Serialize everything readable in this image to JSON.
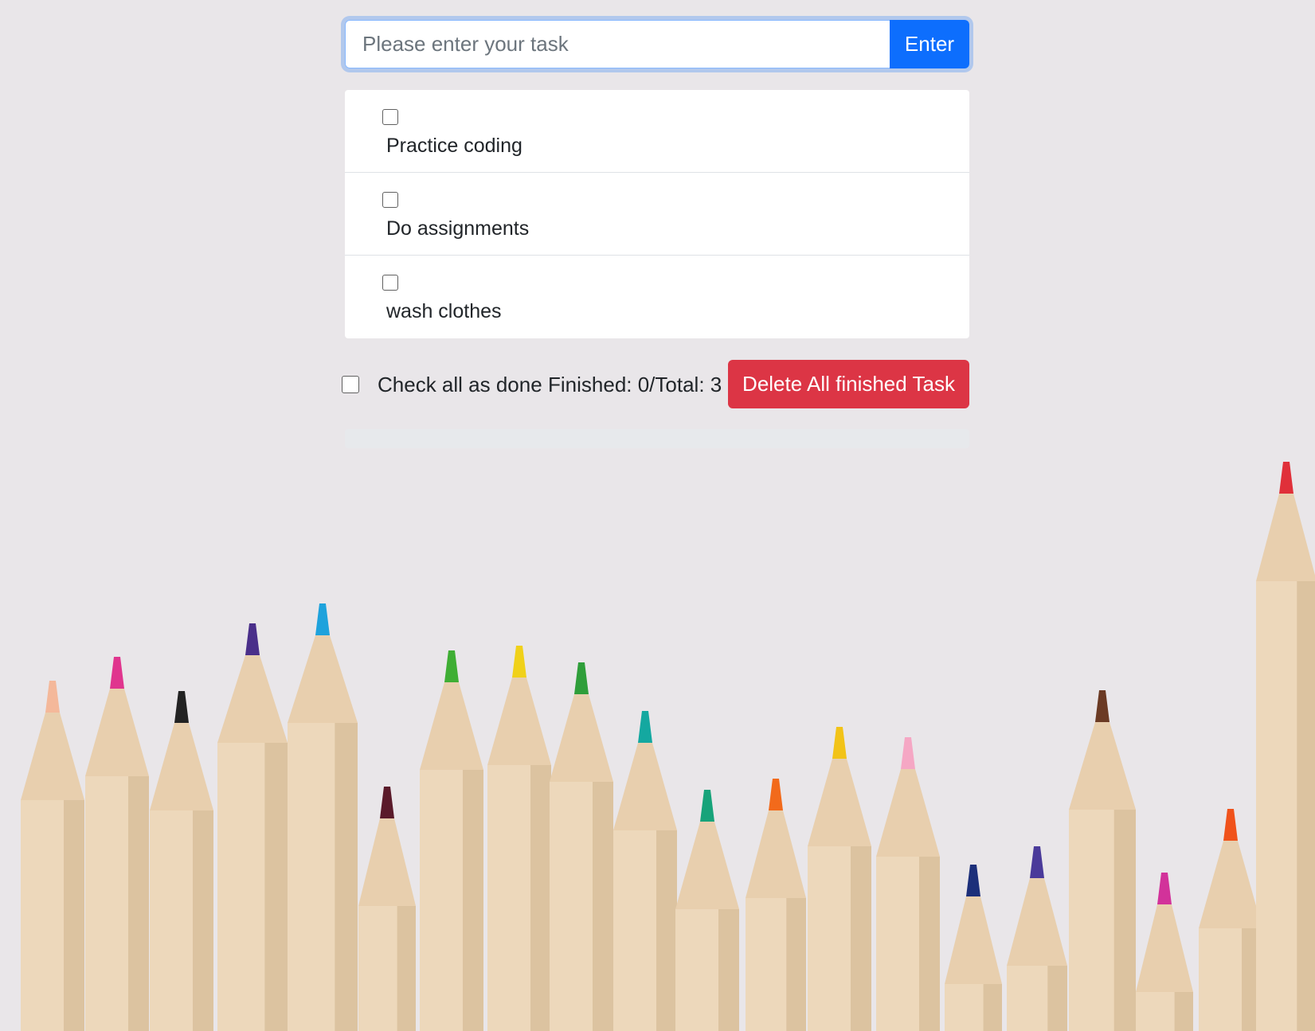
{
  "task_input": {
    "placeholder": "Please enter your task",
    "value": ""
  },
  "enter_button": {
    "label": "Enter"
  },
  "tasks": [
    {
      "label": "Practice coding",
      "done": false
    },
    {
      "label": "Do assignments",
      "done": false
    },
    {
      "label": "wash clothes",
      "done": false
    }
  ],
  "footer": {
    "check_all_label": "Check all as done",
    "status_text": "Finished: 0/Total: 3",
    "delete_label": "Delete All finished Task"
  },
  "progress": {
    "finished": 0,
    "total": 3,
    "fraction": 0
  },
  "colors": {
    "primary": "#0d6efd",
    "danger": "#dc3545",
    "background": "#e9e6e9"
  },
  "background_image": {
    "subject": "colored-pencils-photo"
  }
}
